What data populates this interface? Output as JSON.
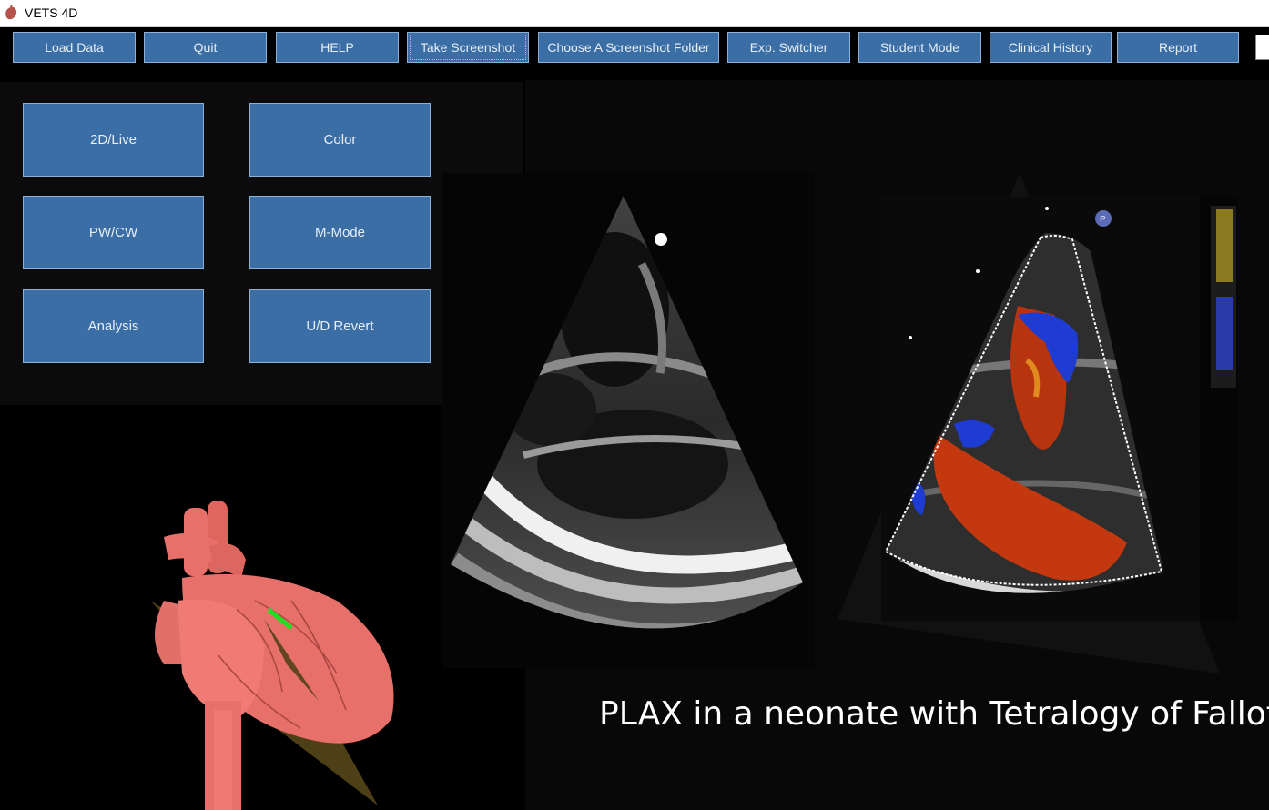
{
  "window": {
    "title": "VETS 4D",
    "icon": "heart-icon"
  },
  "toolbar": {
    "buttons": [
      {
        "label": "Load Data"
      },
      {
        "label": "Quit"
      },
      {
        "label": "HELP"
      },
      {
        "label": "Take Screenshot",
        "focused": true
      },
      {
        "label": "Choose A Screenshot Folder"
      },
      {
        "label": "Exp. Switcher"
      },
      {
        "label": "Student Mode"
      },
      {
        "label": "Clinical History"
      },
      {
        "label": "Report"
      }
    ]
  },
  "modes": {
    "items": [
      {
        "label": "2D/Live"
      },
      {
        "label": "Color"
      },
      {
        "label": "PW/CW"
      },
      {
        "label": "M-Mode"
      },
      {
        "label": "Analysis"
      },
      {
        "label": "U/D Revert"
      }
    ]
  },
  "views": {
    "heart_model": "3d-heart-model",
    "bmode": "plax-bmode-image",
    "color": "plax-color-doppler-image",
    "caption": "PLAX in a neonate with Tetralogy of Fallot"
  },
  "colors": {
    "button_bg": "#3a6ea5",
    "button_border": "#8fb0d6",
    "heart": "#e8706a",
    "doppler_red": "#c8320f",
    "doppler_blue": "#1e3cd2"
  }
}
